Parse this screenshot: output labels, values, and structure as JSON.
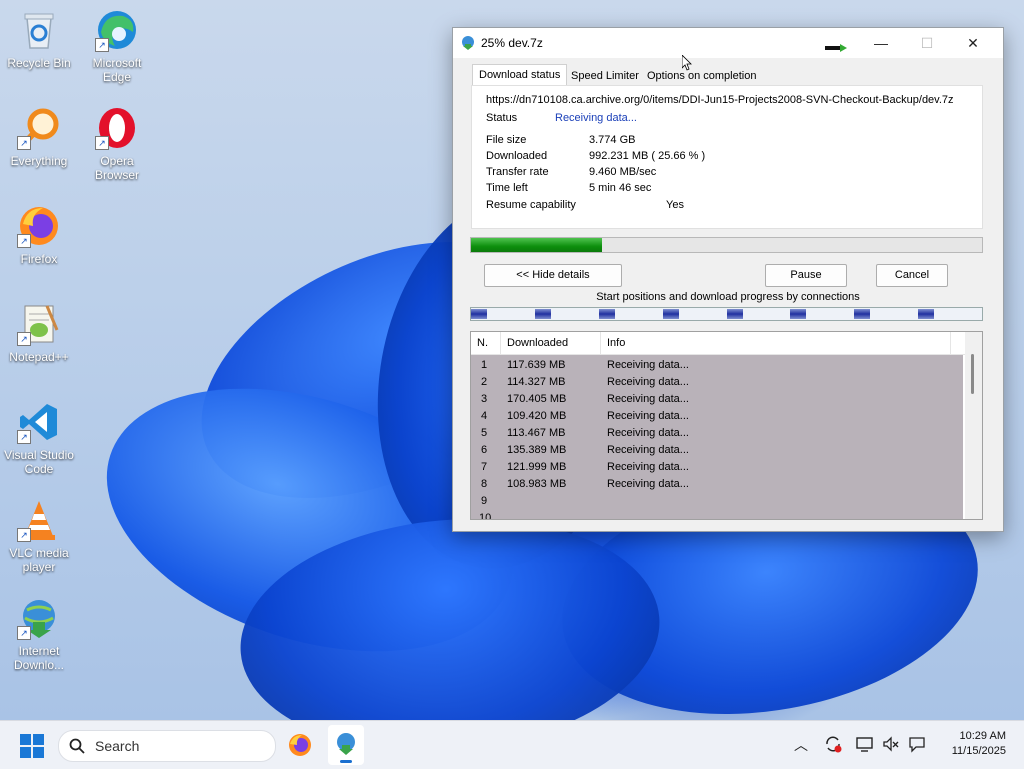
{
  "desktop": {
    "icons": [
      {
        "name": "recycle-bin",
        "label": "Recycle Bin",
        "icon": "recycle-bin-icon"
      },
      {
        "name": "microsoft-edge",
        "label": "Microsoft Edge",
        "icon": "edge-icon"
      },
      {
        "name": "everything",
        "label": "Everything",
        "icon": "search-magnifier-icon"
      },
      {
        "name": "opera-browser",
        "label": "Opera Browser",
        "icon": "opera-icon"
      },
      {
        "name": "firefox",
        "label": "Firefox",
        "icon": "firefox-icon"
      },
      {
        "name": "notepad-plus-plus",
        "label": "Notepad++",
        "icon": "notepad-icon"
      },
      {
        "name": "visual-studio-code",
        "label": "Visual Studio Code",
        "icon": "vscode-icon"
      },
      {
        "name": "vlc-media-player",
        "label": "VLC media player",
        "icon": "vlc-icon"
      },
      {
        "name": "internet-download-manager",
        "label": "Internet Downlo...",
        "icon": "idm-icon"
      }
    ]
  },
  "window": {
    "title": "25% dev.7z",
    "minimize": "—",
    "maximize": "☐",
    "close": "✕",
    "tabs": [
      {
        "label": "Download status",
        "active": true
      },
      {
        "label": "Speed Limiter",
        "active": false
      },
      {
        "label": "Options on completion",
        "active": false
      }
    ],
    "url": "https://dn710108.ca.archive.org/0/items/DDI-Jun15-Projects2008-SVN-Checkout-Backup/dev.7z",
    "status_label": "Status",
    "status_value": "Receiving data...",
    "file_size_label": "File size",
    "file_size_value": "3.774  GB",
    "downloaded_label": "Downloaded",
    "downloaded_value": "992.231  MB  ( 25.66 % )",
    "transfer_rate_label": "Transfer rate",
    "transfer_rate_value": "9.460  MB/sec",
    "time_left_label": "Time left",
    "time_left_value": "5 min 46 sec",
    "resume_label": "Resume capability",
    "resume_value": "Yes",
    "progress_fraction": 0.2566,
    "hide_details_button": "<< Hide details",
    "pause_button": "Pause",
    "cancel_button": "Cancel",
    "connections_caption": "Start positions and download progress by connections",
    "connections_count": 8,
    "table": {
      "columns": [
        "N.",
        "Downloaded",
        "Info"
      ],
      "rows": [
        {
          "n": "1",
          "downloaded": "117.639  MB",
          "info": "Receiving data..."
        },
        {
          "n": "2",
          "downloaded": "114.327  MB",
          "info": "Receiving data..."
        },
        {
          "n": "3",
          "downloaded": "170.405  MB",
          "info": "Receiving data..."
        },
        {
          "n": "4",
          "downloaded": "109.420  MB",
          "info": "Receiving data..."
        },
        {
          "n": "5",
          "downloaded": "113.467  MB",
          "info": "Receiving data..."
        },
        {
          "n": "6",
          "downloaded": "135.389  MB",
          "info": "Receiving data..."
        },
        {
          "n": "7",
          "downloaded": "121.999  MB",
          "info": "Receiving data..."
        },
        {
          "n": "8",
          "downloaded": "108.983  MB",
          "info": "Receiving data..."
        },
        {
          "n": "9",
          "downloaded": "",
          "info": ""
        },
        {
          "n": "10",
          "downloaded": "",
          "info": ""
        }
      ]
    }
  },
  "taskbar": {
    "search_placeholder": "Search",
    "time": "10:29 AM",
    "date": "11/15/2025",
    "pinned": [
      {
        "name": "start-button",
        "icon": "windows-logo-icon"
      },
      {
        "name": "firefox-taskbar",
        "icon": "firefox-icon"
      },
      {
        "name": "idm-taskbar",
        "icon": "idm-icon"
      }
    ],
    "tray": [
      "chevron-up-icon",
      "sync-icon",
      "monitor-icon",
      "mute-icon",
      "chat-icon"
    ]
  }
}
